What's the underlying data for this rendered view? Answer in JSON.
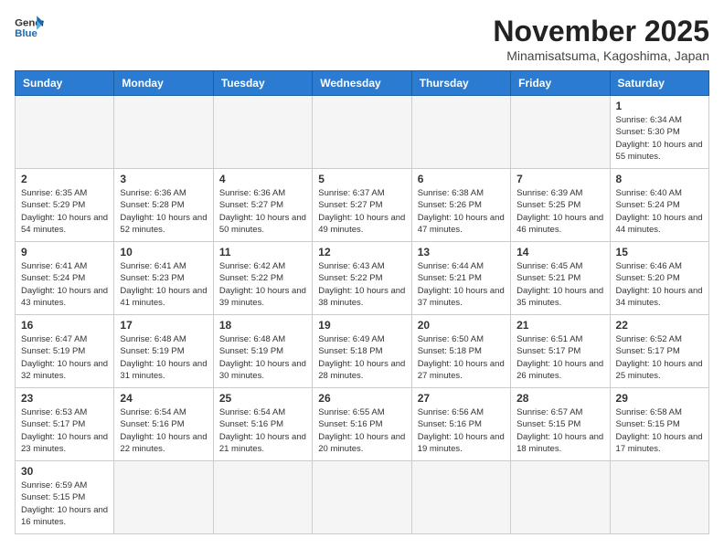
{
  "header": {
    "logo_general": "General",
    "logo_blue": "Blue",
    "month": "November 2025",
    "location": "Minamisatsuma, Kagoshima, Japan"
  },
  "weekdays": [
    "Sunday",
    "Monday",
    "Tuesday",
    "Wednesday",
    "Thursday",
    "Friday",
    "Saturday"
  ],
  "weeks": [
    [
      {
        "day": "",
        "info": ""
      },
      {
        "day": "",
        "info": ""
      },
      {
        "day": "",
        "info": ""
      },
      {
        "day": "",
        "info": ""
      },
      {
        "day": "",
        "info": ""
      },
      {
        "day": "",
        "info": ""
      },
      {
        "day": "1",
        "info": "Sunrise: 6:34 AM\nSunset: 5:30 PM\nDaylight: 10 hours and 55 minutes."
      }
    ],
    [
      {
        "day": "2",
        "info": "Sunrise: 6:35 AM\nSunset: 5:29 PM\nDaylight: 10 hours and 54 minutes."
      },
      {
        "day": "3",
        "info": "Sunrise: 6:36 AM\nSunset: 5:28 PM\nDaylight: 10 hours and 52 minutes."
      },
      {
        "day": "4",
        "info": "Sunrise: 6:36 AM\nSunset: 5:27 PM\nDaylight: 10 hours and 50 minutes."
      },
      {
        "day": "5",
        "info": "Sunrise: 6:37 AM\nSunset: 5:27 PM\nDaylight: 10 hours and 49 minutes."
      },
      {
        "day": "6",
        "info": "Sunrise: 6:38 AM\nSunset: 5:26 PM\nDaylight: 10 hours and 47 minutes."
      },
      {
        "day": "7",
        "info": "Sunrise: 6:39 AM\nSunset: 5:25 PM\nDaylight: 10 hours and 46 minutes."
      },
      {
        "day": "8",
        "info": "Sunrise: 6:40 AM\nSunset: 5:24 PM\nDaylight: 10 hours and 44 minutes."
      }
    ],
    [
      {
        "day": "9",
        "info": "Sunrise: 6:41 AM\nSunset: 5:24 PM\nDaylight: 10 hours and 43 minutes."
      },
      {
        "day": "10",
        "info": "Sunrise: 6:41 AM\nSunset: 5:23 PM\nDaylight: 10 hours and 41 minutes."
      },
      {
        "day": "11",
        "info": "Sunrise: 6:42 AM\nSunset: 5:22 PM\nDaylight: 10 hours and 39 minutes."
      },
      {
        "day": "12",
        "info": "Sunrise: 6:43 AM\nSunset: 5:22 PM\nDaylight: 10 hours and 38 minutes."
      },
      {
        "day": "13",
        "info": "Sunrise: 6:44 AM\nSunset: 5:21 PM\nDaylight: 10 hours and 37 minutes."
      },
      {
        "day": "14",
        "info": "Sunrise: 6:45 AM\nSunset: 5:21 PM\nDaylight: 10 hours and 35 minutes."
      },
      {
        "day": "15",
        "info": "Sunrise: 6:46 AM\nSunset: 5:20 PM\nDaylight: 10 hours and 34 minutes."
      }
    ],
    [
      {
        "day": "16",
        "info": "Sunrise: 6:47 AM\nSunset: 5:19 PM\nDaylight: 10 hours and 32 minutes."
      },
      {
        "day": "17",
        "info": "Sunrise: 6:48 AM\nSunset: 5:19 PM\nDaylight: 10 hours and 31 minutes."
      },
      {
        "day": "18",
        "info": "Sunrise: 6:48 AM\nSunset: 5:19 PM\nDaylight: 10 hours and 30 minutes."
      },
      {
        "day": "19",
        "info": "Sunrise: 6:49 AM\nSunset: 5:18 PM\nDaylight: 10 hours and 28 minutes."
      },
      {
        "day": "20",
        "info": "Sunrise: 6:50 AM\nSunset: 5:18 PM\nDaylight: 10 hours and 27 minutes."
      },
      {
        "day": "21",
        "info": "Sunrise: 6:51 AM\nSunset: 5:17 PM\nDaylight: 10 hours and 26 minutes."
      },
      {
        "day": "22",
        "info": "Sunrise: 6:52 AM\nSunset: 5:17 PM\nDaylight: 10 hours and 25 minutes."
      }
    ],
    [
      {
        "day": "23",
        "info": "Sunrise: 6:53 AM\nSunset: 5:17 PM\nDaylight: 10 hours and 23 minutes."
      },
      {
        "day": "24",
        "info": "Sunrise: 6:54 AM\nSunset: 5:16 PM\nDaylight: 10 hours and 22 minutes."
      },
      {
        "day": "25",
        "info": "Sunrise: 6:54 AM\nSunset: 5:16 PM\nDaylight: 10 hours and 21 minutes."
      },
      {
        "day": "26",
        "info": "Sunrise: 6:55 AM\nSunset: 5:16 PM\nDaylight: 10 hours and 20 minutes."
      },
      {
        "day": "27",
        "info": "Sunrise: 6:56 AM\nSunset: 5:16 PM\nDaylight: 10 hours and 19 minutes."
      },
      {
        "day": "28",
        "info": "Sunrise: 6:57 AM\nSunset: 5:15 PM\nDaylight: 10 hours and 18 minutes."
      },
      {
        "day": "29",
        "info": "Sunrise: 6:58 AM\nSunset: 5:15 PM\nDaylight: 10 hours and 17 minutes."
      }
    ],
    [
      {
        "day": "30",
        "info": "Sunrise: 6:59 AM\nSunset: 5:15 PM\nDaylight: 10 hours and 16 minutes."
      },
      {
        "day": "",
        "info": ""
      },
      {
        "day": "",
        "info": ""
      },
      {
        "day": "",
        "info": ""
      },
      {
        "day": "",
        "info": ""
      },
      {
        "day": "",
        "info": ""
      },
      {
        "day": "",
        "info": ""
      }
    ]
  ]
}
